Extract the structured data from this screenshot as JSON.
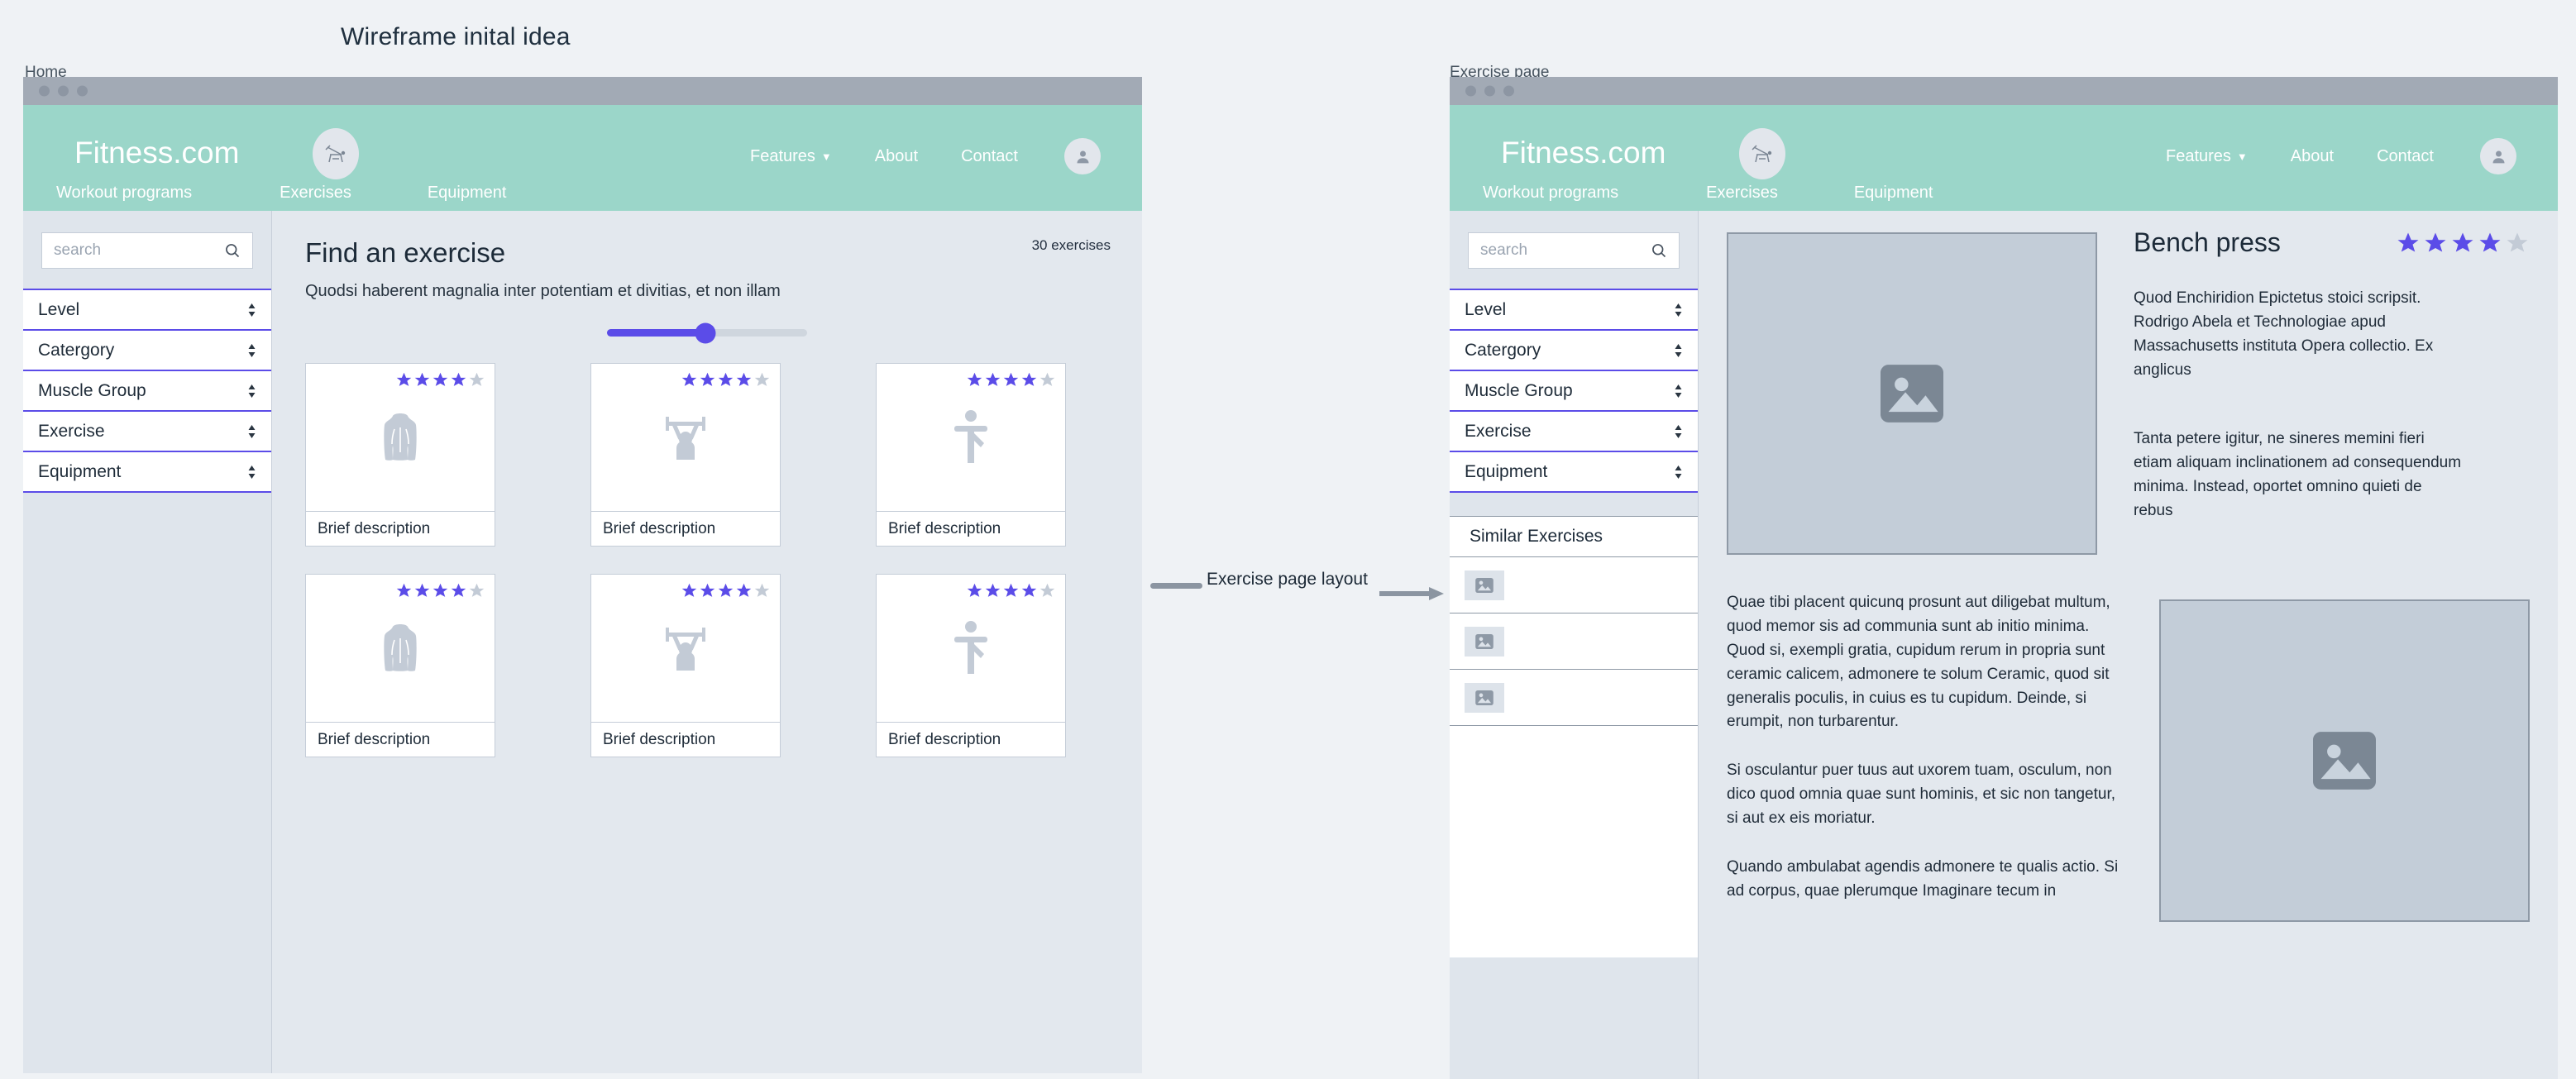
{
  "board": {
    "title": "Wireframe inital idea"
  },
  "frames": [
    {
      "label": "Home"
    },
    {
      "label": "Exercise page"
    }
  ],
  "connector": {
    "label": "Exercise page layout",
    "arrow_icon": "arrow-right-icon"
  },
  "site": {
    "brand": "Fitness.com",
    "brand_icon": "bench-press-icon",
    "avatar_icon": "user-avatar-icon",
    "nav": [
      {
        "label": "Features",
        "icon": "chevron-down-icon",
        "has_caret": true
      },
      {
        "label": "About",
        "has_caret": false
      },
      {
        "label": "Contact",
        "has_caret": false
      }
    ],
    "subnav": [
      {
        "label": "Workout programs"
      },
      {
        "label": "Exercises"
      },
      {
        "label": "Equipment"
      }
    ]
  },
  "sidebar": {
    "search": {
      "placeholder": "search",
      "value": "",
      "icon": "search-icon"
    },
    "filters": [
      {
        "label": "Level",
        "icon": "stepper-icon"
      },
      {
        "label": "Catergory",
        "icon": "stepper-icon"
      },
      {
        "label": "Muscle Group",
        "icon": "stepper-icon"
      },
      {
        "label": "Exercise",
        "icon": "stepper-icon"
      },
      {
        "label": "Equipment",
        "icon": "stepper-icon"
      }
    ]
  },
  "home_page": {
    "heading": "Find an exercise",
    "subheading": "Quodsi haberent magnalia inter potentiam et divitias, et non illam",
    "count_label": "30 exercises",
    "slider": {
      "value_percent": 49
    },
    "cards": [
      {
        "description": "Brief description",
        "icon": "back-muscle-icon",
        "rating": 4,
        "max_rating": 5
      },
      {
        "description": "Brief description",
        "icon": "weightlifter-icon",
        "rating": 4,
        "max_rating": 5
      },
      {
        "description": "Brief description",
        "icon": "yoga-balance-icon",
        "rating": 4,
        "max_rating": 5
      },
      {
        "description": "Brief description",
        "icon": "back-muscle-icon",
        "rating": 4,
        "max_rating": 5
      },
      {
        "description": "Brief description",
        "icon": "weightlifter-icon",
        "rating": 4,
        "max_rating": 5
      },
      {
        "description": "Brief description",
        "icon": "yoga-balance-icon",
        "rating": 4,
        "max_rating": 5
      }
    ]
  },
  "exercise_page": {
    "title": "Bench press",
    "rating": 4,
    "max_rating": 5,
    "hero_image_icon": "image-placeholder-icon",
    "secondary_image_icon": "image-placeholder-icon",
    "intro_paragraphs": [
      "Quod Enchiridion Epictetus stoici scripsit. Rodrigo Abela et Technologiae apud Massachusetts instituta Opera collectio. Ex anglicus",
      "Tanta petere igitur, ne sineres memini fieri etiam aliquam inclinationem ad consequendum minima. Instead, oportet omnino quieti de rebus"
    ],
    "body_paragraphs": [
      "Quae tibi placent quicunq prosunt aut diligebat multum, quod memor sis ad communia sunt ab initio minima. Quod si, exempli gratia, cupidum rerum in propria sunt ceramic calicem, admonere te solum Ceramic, quod sit generalis poculis, in cuius es tu cupidum. Deinde, si erumpit, non turbarentur.",
      "Si osculantur puer tuus aut uxorem tuam, osculum, non dico quod omnia quae sunt hominis, et sic non tangetur, si aut ex eis moriatur.",
      "Quando ambulabat agendis admonere te qualis actio. Si ad corpus, quae plerumque Imaginare tecum in"
    ],
    "similar": {
      "heading": "Similar Exercises",
      "items": [
        {
          "icon": "image-placeholder-icon"
        },
        {
          "icon": "image-placeholder-icon"
        },
        {
          "icon": "image-placeholder-icon"
        }
      ]
    }
  },
  "colors": {
    "teal": "#9bd6c9",
    "purple": "#5b4ce8",
    "star_empty": "#c3cbd6",
    "canvas": "#eff2f5",
    "chrome": "#a2aab5"
  }
}
